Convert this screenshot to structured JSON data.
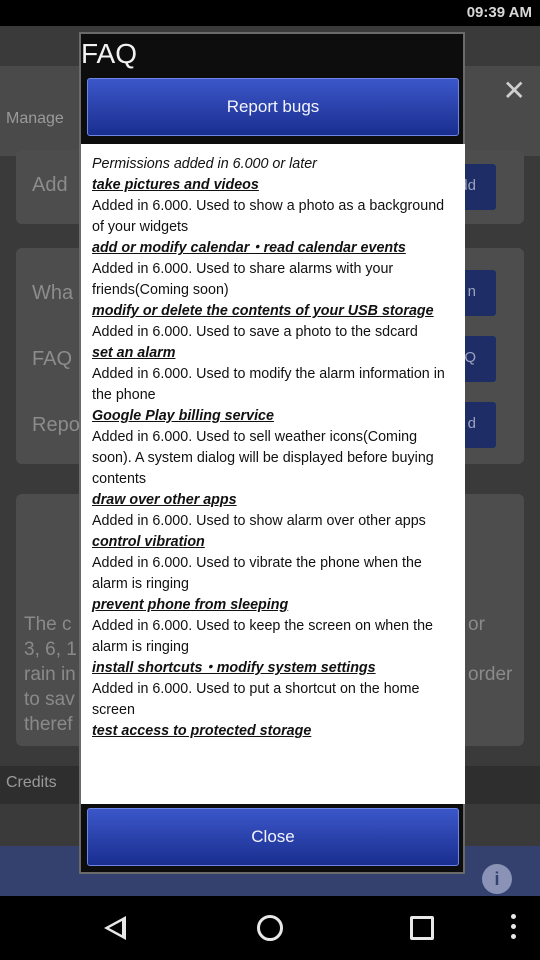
{
  "status_bar": {
    "time": "09:39 AM"
  },
  "background": {
    "manage_label": "Manage",
    "close_symbol": "✕",
    "rows": [
      {
        "label": "Add",
        "button": "add"
      },
      {
        "label": "Wha",
        "button": "n"
      },
      {
        "label": "FAQ",
        "button": "AQ"
      },
      {
        "label": "Repo",
        "button": "d"
      }
    ],
    "body_lines": [
      "The c",
      "3, 6, 1",
      "rain in",
      "to sav",
      "theref"
    ],
    "body_right_lines": [
      "or",
      "order"
    ],
    "credits_label": "Credits"
  },
  "dialog": {
    "title": "FAQ",
    "report_button": "Report bugs",
    "close_button": "Close",
    "intro": "Permissions added in 6.000 or later",
    "permissions": [
      {
        "name": "take pictures and videos",
        "desc": "Added in 6.000. Used to show a photo as a background of your widgets"
      },
      {
        "name": "add or modify calendar・read calendar events",
        "desc": "Added in 6.000. Used to share alarms with your friends(Coming soon)"
      },
      {
        "name": "modify or delete the contents of your USB storage",
        "desc": "Added in 6.000. Used to save a photo to the sdcard"
      },
      {
        "name": "set an alarm",
        "desc": "Added in 6.000. Used to modify the alarm information in the phone"
      },
      {
        "name": "Google Play billing service",
        "desc": "Added in 6.000. Used to sell weather icons(Coming soon). A system dialog will be displayed before buying contents"
      },
      {
        "name": "draw over other apps",
        "desc": "Added in 6.000. Used to show alarm over other apps"
      },
      {
        "name": "control vibration",
        "desc": "Added in 6.000. Used to vibrate the phone when the alarm is ringing"
      },
      {
        "name": "prevent phone from sleeping",
        "desc": "Added in 6.000. Used to keep the screen on when the alarm is ringing"
      },
      {
        "name": "install shortcuts・modify system settings",
        "desc": "Added in 6.000. Used to put a shortcut on the home screen"
      },
      {
        "name": "test access to protected storage",
        "desc": ""
      }
    ]
  },
  "icons": {
    "back": "back-icon",
    "home": "home-icon",
    "recent": "recent-apps-icon",
    "menu": "overflow-menu-icon",
    "info": "info-icon"
  },
  "colors": {
    "dialog_button": "#2a43b0",
    "bottom_bar": "#34406e",
    "content_bg": "#ffffff"
  }
}
